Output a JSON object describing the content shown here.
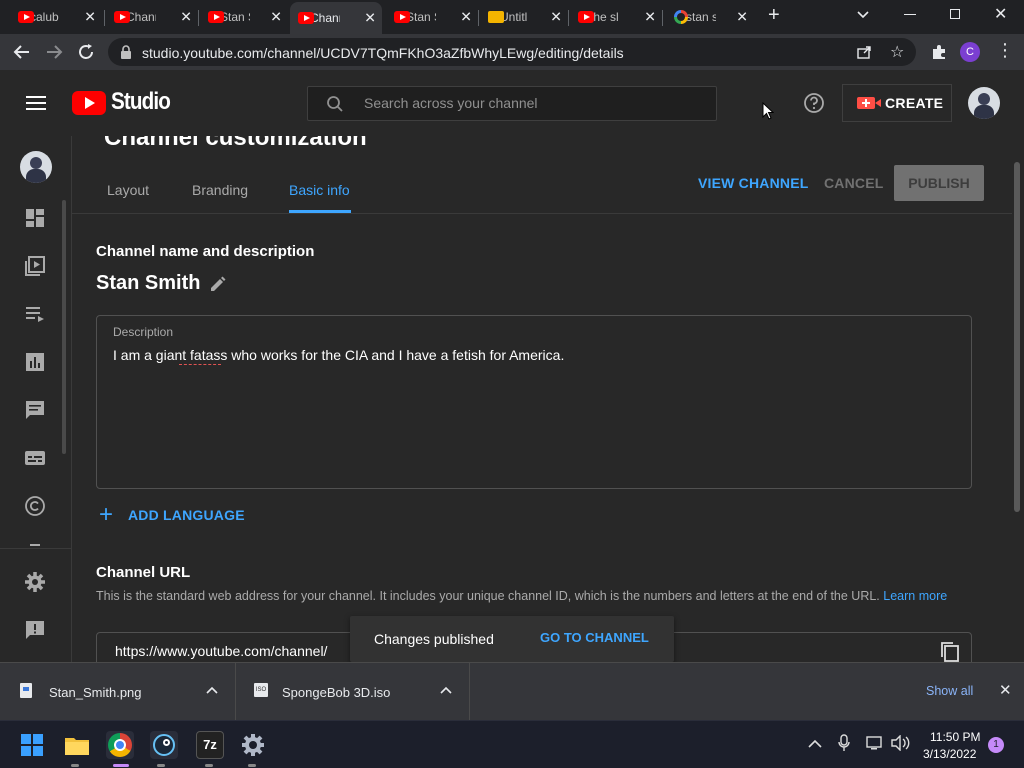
{
  "browser": {
    "tabs": [
      {
        "title": "calub",
        "favicon": "youtube-icon"
      },
      {
        "title": "Chann",
        "favicon": "youtube-icon"
      },
      {
        "title": "Stan S",
        "favicon": "youtube-icon"
      },
      {
        "title": "Chann",
        "favicon": "youtube-icon",
        "active": true
      },
      {
        "title": "Stan S",
        "favicon": "youtube-icon"
      },
      {
        "title": "Untitl",
        "favicon": "docs-icon"
      },
      {
        "title": "the sl",
        "favicon": "youtube-icon"
      },
      {
        "title": "stan s",
        "favicon": "google-icon"
      }
    ],
    "url": "studio.youtube.com/channel/UCDV7TQmFKhO3aZfbWhyLEwg/editing/details",
    "profile_initial": "C"
  },
  "header": {
    "logo_text": "Studio",
    "search_placeholder": "Search across your channel",
    "create_label": "CREATE"
  },
  "page": {
    "heading": "Channel customization",
    "tabs": [
      "Layout",
      "Branding",
      "Basic info"
    ],
    "active_tab": "Basic info",
    "view_channel_label": "VIEW CHANNEL",
    "cancel_label": "CANCEL",
    "publish_label": "PUBLISH",
    "section1_title": "Channel name and description",
    "channel_name": "Stan Smith",
    "description_label": "Description",
    "description_text": "I am a giant fatass who works for the CIA and I have a fetish for America.",
    "add_language_label": "ADD LANGUAGE",
    "url_title": "Channel URL",
    "url_help": "This is the standard web address for your channel. It includes your unique channel ID, which is the numbers and letters at the end of the URL.",
    "learn_more": "Learn more",
    "channel_url": "https://www.youtube.com/channel/"
  },
  "toast": {
    "message": "Changes published",
    "action": "GO TO CHANNEL"
  },
  "downloads": {
    "items": [
      {
        "name": "Stan_Smith.png"
      },
      {
        "name": "SpongeBob 3D.iso"
      }
    ],
    "show_all": "Show all"
  },
  "taskbar": {
    "time": "11:50 PM",
    "date": "3/13/2022",
    "notification_count": "1",
    "seven_zip_label": "7z"
  },
  "colors": {
    "accent_blue": "#3ea6ff",
    "yt_red": "#ff0000",
    "surface": "#282828"
  }
}
